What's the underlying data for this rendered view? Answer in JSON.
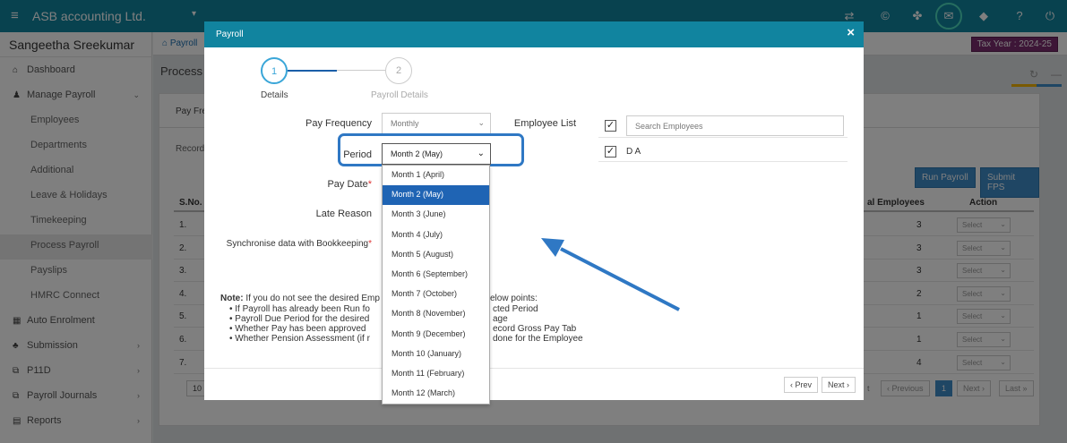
{
  "topbar": {
    "company": "ASB accounting Ltd."
  },
  "sidebar": {
    "user": "Sangeetha Sreekumar",
    "items": [
      {
        "label": "Dashboard"
      },
      {
        "label": "Manage Payroll"
      },
      {
        "label": "Employees"
      },
      {
        "label": "Departments"
      },
      {
        "label": "Additional"
      },
      {
        "label": "Leave & Holidays"
      },
      {
        "label": "Timekeeping"
      },
      {
        "label": "Process Payroll"
      },
      {
        "label": "Payslips"
      },
      {
        "label": "HMRC Connect"
      },
      {
        "label": "Auto Enrolment"
      },
      {
        "label": "Submission"
      },
      {
        "label": "P11D"
      },
      {
        "label": "Payroll Journals"
      },
      {
        "label": "Reports"
      }
    ]
  },
  "main": {
    "breadcrumb": "Payroll",
    "tax_year": "Tax Year : 2024-25",
    "page_title": "Process",
    "tab_pay": "Pay Fre",
    "tab_record": "Record",
    "run_payroll": "Run Payroll",
    "submit_fps": "Submit FPS",
    "table": {
      "col_sno": "S.No.",
      "col_total": "al Employees",
      "col_action": "Action",
      "rows": [
        {
          "sno": "1.",
          "count": "3",
          "action": "Select"
        },
        {
          "sno": "2.",
          "count": "3",
          "action": "Select"
        },
        {
          "sno": "3.",
          "count": "3",
          "action": "Select"
        },
        {
          "sno": "4.",
          "count": "2",
          "action": "Select"
        },
        {
          "sno": "5.",
          "count": "1",
          "action": "Select"
        },
        {
          "sno": "6.",
          "count": "1",
          "action": "Select"
        },
        {
          "sno": "7.",
          "count": "4",
          "action": "Select"
        }
      ]
    },
    "page_size": "10",
    "pager": {
      "first_partial": "t",
      "previous": "‹ Previous",
      "current": "1",
      "next": "Next ›",
      "last": "Last »"
    }
  },
  "modal": {
    "title": "Payroll",
    "close": "×",
    "steps": [
      {
        "num": "1",
        "label": "Details"
      },
      {
        "num": "2",
        "label": "Payroll Details"
      }
    ],
    "pay_frequency_label": "Pay Frequency",
    "pay_frequency_value": "Monthly",
    "period_label": "Period",
    "period_value": "Month 2 (May)",
    "pay_date_label": "Pay Date",
    "late_reason_label": "Late Reason",
    "sync_label": "Synchronise data with Bookkeeping",
    "required_mark": "*",
    "employee_list_label": "Employee List",
    "search_placeholder": "Search Employees",
    "employees": [
      {
        "name": "D A"
      }
    ],
    "note_prefix": "Note:",
    "note_text": "If you do not see the desired Emp",
    "note_text_end": "elow points:",
    "bullets": [
      {
        "a": "If Payroll has already been Run fo",
        "b": "cted Period"
      },
      {
        "a": "Payroll Due Period for the desired",
        "b": "age"
      },
      {
        "a": "Whether Pay has been approved",
        "b": "ecord Gross Pay Tab"
      },
      {
        "a": "Whether Pension Assessment (if r",
        "b": "done for the Employee"
      }
    ],
    "prev": "‹ Prev",
    "next": "Next ›",
    "period_options": [
      {
        "label": "Month 1 (April)"
      },
      {
        "label": "Month 2 (May)"
      },
      {
        "label": "Month 3 (June)"
      },
      {
        "label": "Month 4 (July)"
      },
      {
        "label": "Month 5 (August)"
      },
      {
        "label": "Month 6 (September)"
      },
      {
        "label": "Month 7 (October)"
      },
      {
        "label": "Month 8 (November)"
      },
      {
        "label": "Month 9 (December)"
      },
      {
        "label": "Month 10 (January)"
      },
      {
        "label": "Month 11 (February)"
      },
      {
        "label": "Month 12 (March)"
      }
    ],
    "selected_index": 1
  },
  "colors": {
    "header": "#11849f",
    "selected_option": "#1f64b4",
    "tax_badge": "#7b2d6e",
    "annotation": "#2f78c4"
  }
}
